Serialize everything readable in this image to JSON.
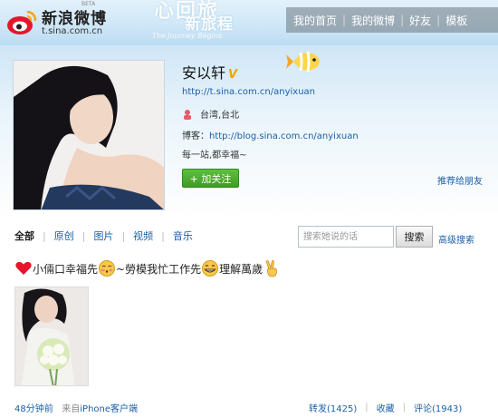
{
  "header": {
    "logo_text": "新浪微博",
    "logo_domain": "t.sina.com.cn",
    "logo_tag": "BETA",
    "banner_main": "心回旅",
    "banner_sub": "新旅程",
    "banner_en": "The Journey Begins",
    "nav": [
      {
        "label": "我的首页"
      },
      {
        "label": "我的微博"
      },
      {
        "label": "好友"
      },
      {
        "label": "模板"
      }
    ],
    "nav_separator": "|"
  },
  "profile": {
    "name": "安以轩",
    "verified_badge": "V",
    "url": "http://t.sina.com.cn/anyixuan",
    "location": "台湾,台北",
    "blog_label": "博客：",
    "blog_url": "http://blog.sina.com.cn/anyixuan",
    "motto": "每一站,都幸福~",
    "follow_label": "+ 加关注",
    "recommend_label": "推荐给朋友"
  },
  "filter": {
    "tabs": [
      {
        "label": "全部",
        "active": true
      },
      {
        "label": "原创",
        "active": false
      },
      {
        "label": "图片",
        "active": false
      },
      {
        "label": "视频",
        "active": false
      },
      {
        "label": "音乐",
        "active": false
      }
    ],
    "tab_separator": "|",
    "search_placeholder": "搜索她说的话",
    "search_button": "搜索",
    "advanced_search": "高级搜索"
  },
  "post": {
    "segments": {
      "seg1": "小倆口幸福先",
      "seg2": "~勞模我忙工作先",
      "seg3": "理解萬歲"
    },
    "emoticons": [
      "heart-icon",
      "shy-face-icon",
      "grin-face-icon",
      "victory-hand-icon"
    ],
    "time": "48分钟前",
    "source_prefix": "来自",
    "source": "iPhone客户端",
    "actions": {
      "repost": "转发(1425)",
      "favorite": "收藏",
      "comment": "评论(1943)"
    },
    "action_separator": "|"
  },
  "colors": {
    "link": "#1a5fa8",
    "follow_button": "#4aa82d",
    "header_bg": "#cfe7f7",
    "nav_bg": "#6e7882"
  }
}
